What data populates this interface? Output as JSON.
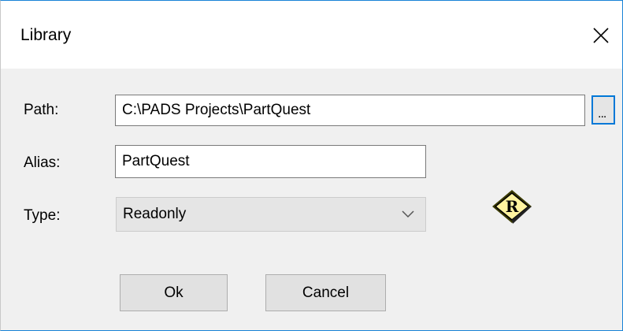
{
  "window": {
    "title": "Library",
    "close_icon": "close-icon"
  },
  "form": {
    "path_label": "Path:",
    "path_value": "C:\\PADS Projects\\PartQuest",
    "browse_label": "...",
    "alias_label": "Alias:",
    "alias_value": "PartQuest",
    "type_label": "Type:",
    "type_selected": "Readonly",
    "readonly_badge_letter": "R"
  },
  "buttons": {
    "ok_label": "Ok",
    "cancel_label": "Cancel"
  },
  "colors": {
    "accent": "#0078d7",
    "badge_fill": "#fff3a0",
    "badge_border": "#3a3a00"
  }
}
